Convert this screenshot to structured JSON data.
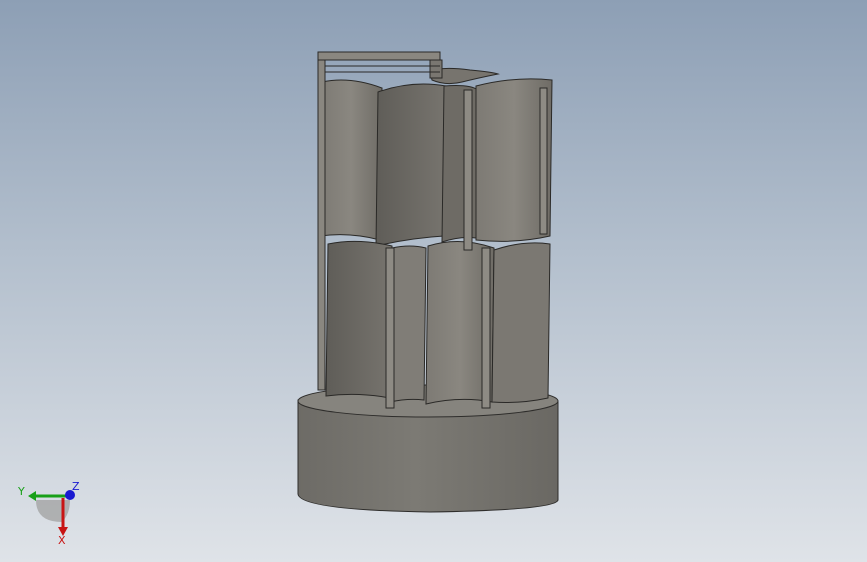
{
  "viewport": {
    "background_top": "#8d9fb5",
    "background_bottom": "#dfe3e8"
  },
  "triad": {
    "x_label": "X",
    "y_label": "Y",
    "z_label": "Z",
    "x_color": "#c81414",
    "y_color": "#18a018",
    "z_color": "#1a1ad0"
  }
}
